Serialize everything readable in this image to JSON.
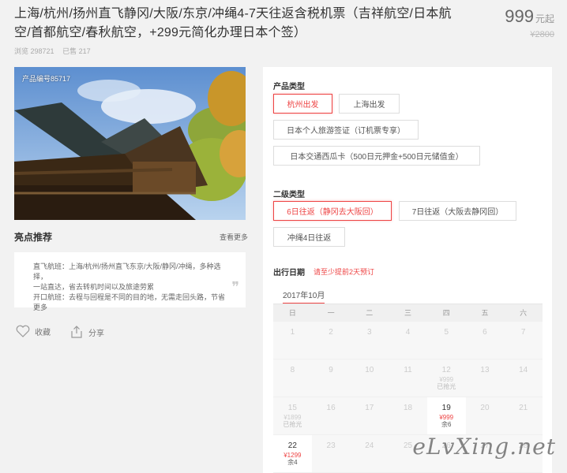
{
  "title": "上海/杭州/扬州直飞静冈/大阪/东京/冲绳4-7天往返含税机票（吉祥航空/日本航空/首都航空/春秋航空，+299元简化办理日本个签）",
  "price": {
    "amount": "999",
    "unit": "元起",
    "original": "¥2800"
  },
  "stats": {
    "views": "浏览 298721",
    "sold": "已售 217"
  },
  "hero": {
    "product_id": "产品编号85717"
  },
  "highlights": {
    "title": "亮点推荐",
    "more": "查看更多",
    "line1": "直飞航班：上海/杭州/扬州直飞东京/大阪/静冈/冲绳，多种选择，",
    "line2": "一站直达，省去转机时间以及旅途劳累",
    "line3": "开口航班：去程与回程是不同的目的地，无需走回头路，节省更多",
    "quote": "❞"
  },
  "actions": {
    "favorite": "收藏",
    "share": "分享"
  },
  "product_type": {
    "label": "产品类型",
    "options": [
      "杭州出发",
      "上海出发",
      "日本个人旅游签证（订机票专享）",
      "日本交通西瓜卡（500日元押金+500日元储值金）"
    ]
  },
  "secondary_type": {
    "label": "二级类型",
    "options": [
      "6日往返（静冈去大阪回）",
      "7日往返（大阪去静冈回）",
      "冲绳4日往返"
    ]
  },
  "departure": {
    "label": "出行日期",
    "hint": "请至少提前2天预订",
    "month": "2017年10月",
    "weekdays": [
      "日",
      "一",
      "二",
      "三",
      "四",
      "五",
      "六"
    ],
    "rows": [
      [
        {
          "d": "1"
        },
        {
          "d": "2"
        },
        {
          "d": "3"
        },
        {
          "d": "4"
        },
        {
          "d": "5"
        },
        {
          "d": "6"
        },
        {
          "d": "7"
        }
      ],
      [
        {
          "d": "8"
        },
        {
          "d": "9"
        },
        {
          "d": "10"
        },
        {
          "d": "11"
        },
        {
          "d": "12",
          "p": "¥999",
          "s": "已抢光"
        },
        {
          "d": "13"
        },
        {
          "d": "14"
        }
      ],
      [
        {
          "d": "15",
          "p": "¥1899",
          "s": "已抢光"
        },
        {
          "d": "16"
        },
        {
          "d": "17"
        },
        {
          "d": "18"
        },
        {
          "d": "19",
          "p": "¥999",
          "s": "余6",
          "av": true
        },
        {
          "d": "20"
        },
        {
          "d": "21"
        }
      ],
      [
        {
          "d": "22",
          "p": "¥1299",
          "s": "余4",
          "av": true
        },
        {
          "d": "23"
        },
        {
          "d": "24"
        },
        {
          "d": "25"
        },
        {
          "d": "26"
        },
        {
          "d": "27"
        },
        {
          "d": "28"
        }
      ]
    ]
  },
  "watermark": "eLvXing.net",
  "colors": {
    "accent": "#e44444",
    "background": "#f2f2f2"
  }
}
